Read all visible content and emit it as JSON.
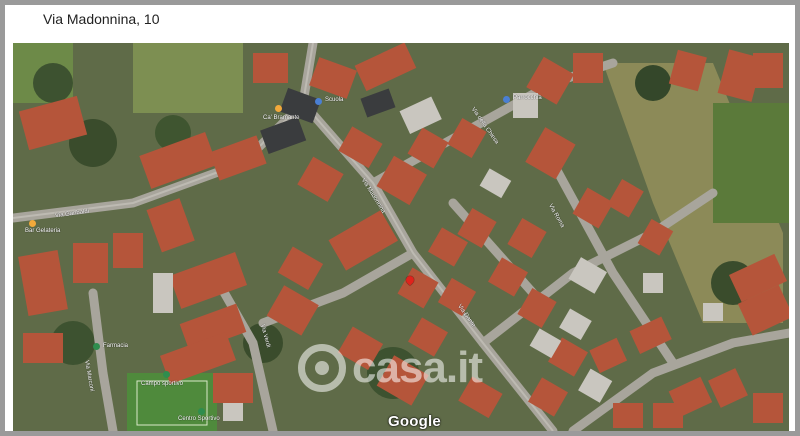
{
  "page": {
    "title": "Via Madonnina, 10"
  },
  "map": {
    "type": "satellite",
    "attribution": "Google",
    "marker_color": "#e0231c",
    "pois": [
      {
        "label": "Bar Gelateria",
        "color": "#f2a93b"
      },
      {
        "label": "Farmacia",
        "color": "#2f8d4e"
      },
      {
        "label": "Parrocchia",
        "color": "#4a7fd4"
      },
      {
        "label": "Ca' Bramante",
        "color": "#f2a93b"
      },
      {
        "label": "Scuola",
        "color": "#4a7fd4"
      },
      {
        "label": "Campo sportivo",
        "color": "#2f8d4e"
      },
      {
        "label": "Centro Sportivo",
        "color": "#2f8d4e"
      }
    ],
    "streets": [
      "Via Madonnina",
      "Via Garibaldi",
      "Via della Chiesa",
      "Via Roma",
      "Via Dante",
      "Via Verdi",
      "Via Marconi"
    ]
  },
  "watermark": {
    "text": "casa.it"
  }
}
